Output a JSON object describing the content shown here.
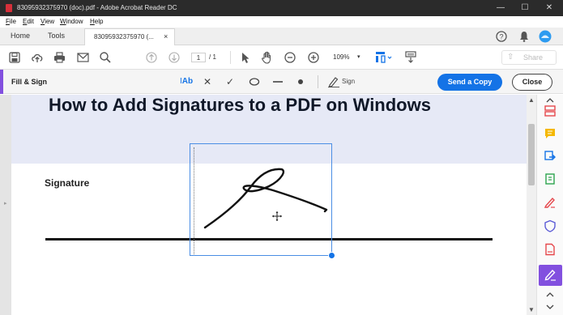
{
  "window": {
    "title": "83095932375970 (doc).pdf - Adobe Acrobat Reader DC",
    "controls": [
      "—",
      "☐",
      "✕"
    ]
  },
  "menu": [
    "File",
    "Edit",
    "View",
    "Window",
    "Help"
  ],
  "tabs": {
    "home": "Home",
    "tools": "Tools",
    "document": "83095932375970 (...",
    "close": "×"
  },
  "toolbar": {
    "current_page": "1",
    "page_total": "/ 1",
    "zoom": "109%",
    "zoom_caret": "▾",
    "share": "Share"
  },
  "fill_sign": {
    "label": "Fill & Sign",
    "text_tool": "Ab",
    "sign": "Sign",
    "send": "Send a Copy",
    "close": "Close"
  },
  "document": {
    "heading": "How to Add Signatures to a PDF on Windows",
    "signature_label": "Signature"
  },
  "colors": {
    "accent": "#8250df",
    "primary": "#1473e6",
    "banner": "#e6e9f6"
  }
}
